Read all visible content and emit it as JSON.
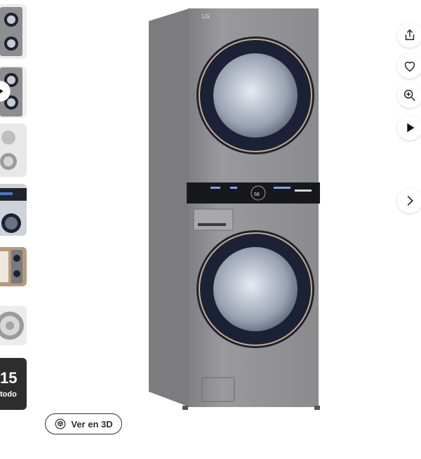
{
  "thumbnails": {
    "more_count": "15",
    "more_label": "todo"
  },
  "product": {
    "brand_badge": "LG",
    "display_reading": "58"
  },
  "actions": {
    "share_icon": "share-icon",
    "favorite_icon": "heart-icon",
    "zoom_icon": "zoom-in-icon",
    "video_icon": "play-icon",
    "next_icon": "chevron-right-icon"
  },
  "view3d": {
    "label": "Ver en 3D"
  },
  "colors": {
    "accent_text": "#2e2f32",
    "appliance_body": "#8d8d8f",
    "door_ring": "#1c2236"
  }
}
